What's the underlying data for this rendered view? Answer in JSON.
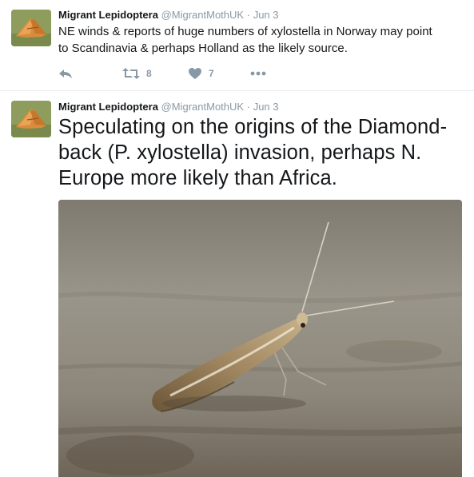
{
  "tweets": [
    {
      "name": "Migrant Lepidoptera",
      "handle": "@MigrantMothUK",
      "dot": "·",
      "time": "Jun 3",
      "text_lines": [
        "NE winds & reports of huge numbers of xylostella in Norway may point",
        "to Scandinavia & perhaps Holland as the likely source."
      ],
      "retweets": "8",
      "likes": "7",
      "icons": {
        "reply": "reply-icon",
        "retweet": "retweet-icon",
        "like": "heart-icon",
        "more": "more-icon"
      }
    },
    {
      "name": "Migrant Lepidoptera",
      "handle": "@MigrantMothUK",
      "dot": "·",
      "time": "Jun 3",
      "text_lines": [
        "Speculating on the origins of the Diamond-",
        "back (P. xylostella) invasion, perhaps N.",
        "Europe more likely than Africa."
      ]
    }
  ],
  "colors": {
    "name": "#14171a",
    "meta": "#8899a6",
    "divider": "#e6ecf0",
    "icon": "#8899a6"
  }
}
